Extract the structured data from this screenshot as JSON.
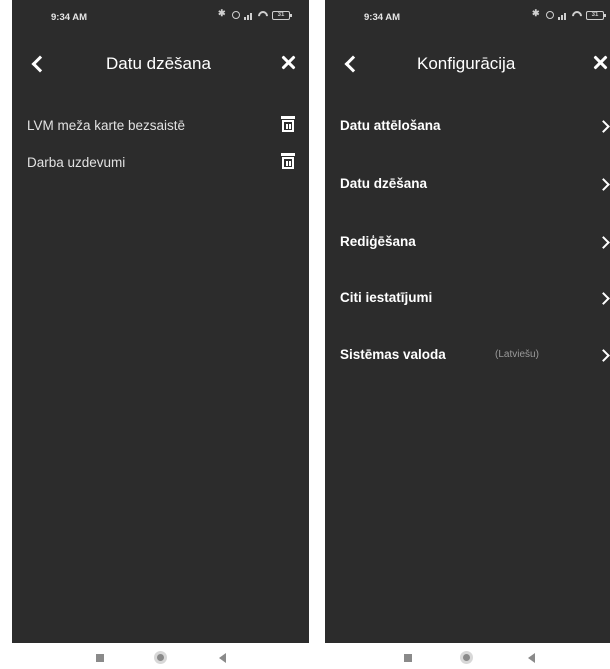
{
  "left_screen": {
    "status": {
      "time": "9:34 AM",
      "battery": "31"
    },
    "header": {
      "title": "Datu dzēšana"
    },
    "items": [
      {
        "label": "LVM meža karte bezsaistē"
      },
      {
        "label": "Darba uzdevumi"
      }
    ]
  },
  "right_screen": {
    "status": {
      "time": "9:34 AM",
      "battery": "31"
    },
    "header": {
      "title": "Konfigurācija"
    },
    "items": [
      {
        "label": "Datu attēlošana"
      },
      {
        "label": "Datu dzēšana"
      },
      {
        "label": "Rediģēšana"
      },
      {
        "label": "Citi iestatījumi"
      },
      {
        "label": "Sistēmas valoda",
        "hint": "(Latviešu)"
      }
    ]
  },
  "icons": {
    "back": "chevron-left-icon",
    "close": "close-icon",
    "delete": "trash-icon",
    "open": "chevron-right-icon",
    "nav": [
      "recent-apps-icon",
      "home-icon",
      "back-triangle-icon"
    ]
  },
  "colors": {
    "background": "#2c2c2c",
    "text": "#ffffff",
    "hint": "#9a9a9a",
    "page": "#ffffff"
  }
}
